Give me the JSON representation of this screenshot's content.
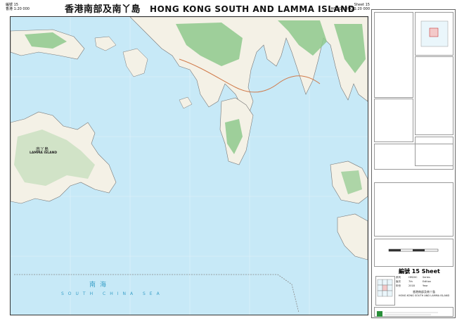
{
  "header": {
    "sheet_label_cn": "編號 15",
    "scale_label_cn": "香港 1:20 000",
    "title_cn": "香港南部及南丫島",
    "title_en": "HONG KONG SOUTH AND LAMMA ISLAND",
    "sheet_label_en": "Sheet 15",
    "scale_label_en": "HONG KONG 1:20 000"
  },
  "map": {
    "island_label_cn": "南丫島",
    "island_label_en": "LAMMA ISLAND",
    "sea_label_cn": "南海",
    "sea_label_en": "SOUTH CHINA SEA",
    "colors": {
      "sea": "#c7e9f7",
      "land": "#f4f1e6",
      "vegetation": "#8ec98c",
      "road": "#d07a4a",
      "grid": "#e2f2f8"
    }
  },
  "legend": {
    "sheet_number": "編號 15 Sheet",
    "series_cn": "系列",
    "series_value": "HM20C",
    "series_en": "Series",
    "edition_cn": "版次",
    "edition_value": "7th",
    "edition_en": "Edition",
    "year_cn": "年份",
    "year_value": "2018",
    "year_en": "Year",
    "sheet_name_cn": "香港南部及南丫島",
    "sheet_name_en": "HONG KONG SOUTH AND LAMMA ISLAND"
  }
}
